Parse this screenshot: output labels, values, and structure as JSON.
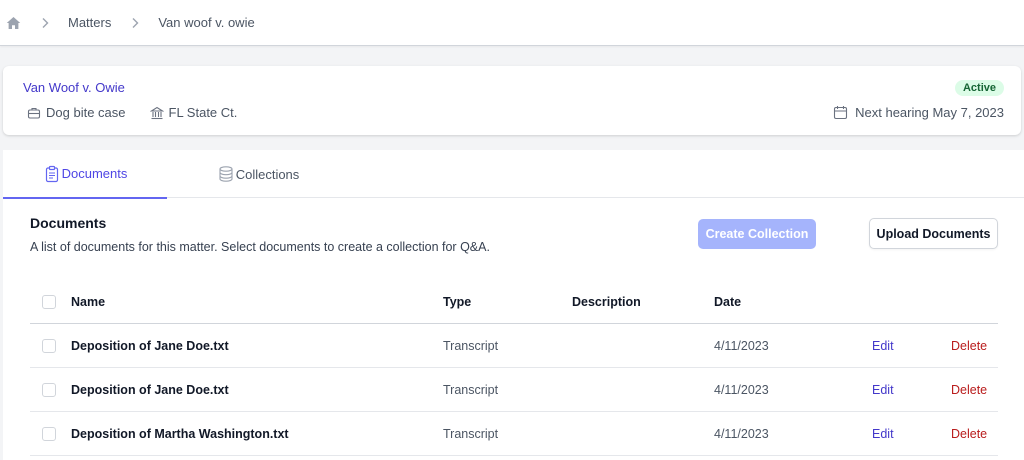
{
  "breadcrumb": {
    "home_icon": "home-icon",
    "items": [
      "Matters",
      "Van woof v. owie"
    ]
  },
  "matter": {
    "title": "Van Woof v. Owie",
    "case_type": "Dog bite case",
    "court": "FL State Ct.",
    "status": "Active",
    "hearing": "Next hearing May 7, 2023"
  },
  "tabs": [
    {
      "label": "Documents",
      "icon": "clipboard-icon",
      "active": true
    },
    {
      "label": "Collections",
      "icon": "database-icon",
      "active": false
    }
  ],
  "documents": {
    "heading": "Documents",
    "description": "A list of documents for this matter. Select documents to create a collection for Q&A.",
    "create_label": "Create Collection",
    "upload_label": "Upload Documents",
    "columns": {
      "name": "Name",
      "type": "Type",
      "description": "Description",
      "date": "Date"
    },
    "rows": [
      {
        "name": "Deposition of Jane Doe.txt",
        "type": "Transcript",
        "description": "",
        "date": "4/11/2023",
        "edit": "Edit",
        "delete": "Delete"
      },
      {
        "name": "Deposition of Jane Doe.txt",
        "type": "Transcript",
        "description": "",
        "date": "4/11/2023",
        "edit": "Edit",
        "delete": "Delete"
      },
      {
        "name": "Deposition of Martha Washington.txt",
        "type": "Transcript",
        "description": "",
        "date": "4/11/2023",
        "edit": "Edit",
        "delete": "Delete"
      }
    ]
  },
  "colors": {
    "accent": "#4f46e5",
    "create_button_disabled": "#a5b4fc",
    "status_bg": "#dcfce7",
    "status_text": "#166534",
    "delete": "#b91c1c"
  }
}
